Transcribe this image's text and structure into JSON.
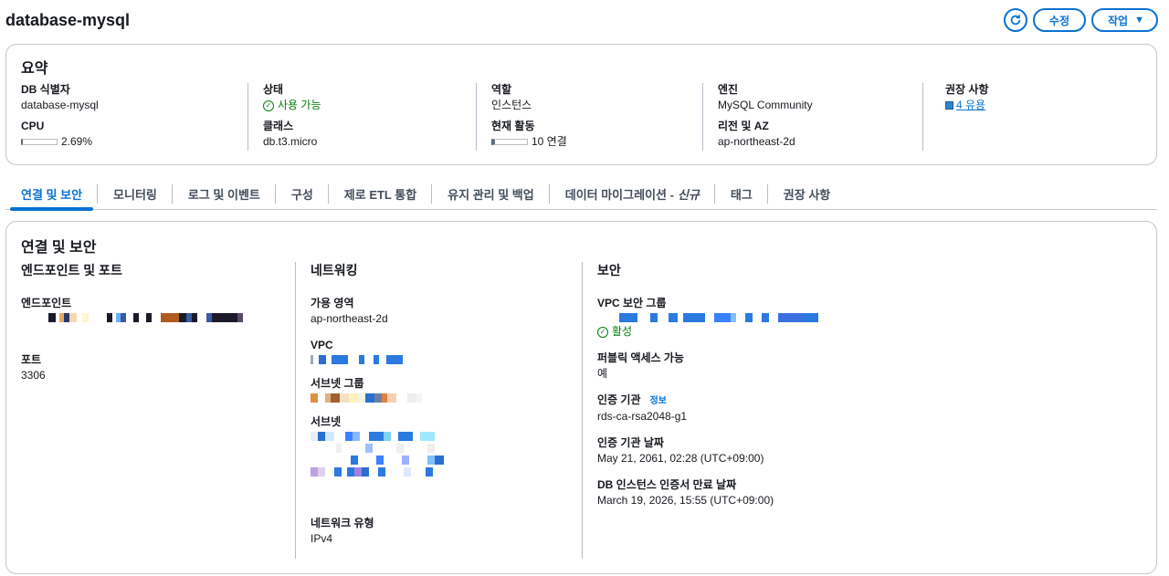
{
  "header": {
    "title": "database-mysql",
    "edit_label": "수정",
    "action_label": "작업"
  },
  "summary": {
    "title": "요약",
    "db_id": {
      "label": "DB 식별자",
      "value": "database-mysql"
    },
    "cpu": {
      "label": "CPU",
      "value": "2.69%",
      "fraction": 0.0269
    },
    "status": {
      "label": "상태",
      "value": "사용 가능"
    },
    "class": {
      "label": "클래스",
      "value": "db.t3.micro"
    },
    "role": {
      "label": "역할",
      "value": "인스턴스"
    },
    "activity": {
      "label": "현재 활동",
      "value": "10 연결"
    },
    "engine": {
      "label": "엔진",
      "value": "MySQL Community"
    },
    "region": {
      "label": "리전 및 AZ",
      "value": "ap-northeast-2d"
    },
    "recommendations": {
      "label": "권장 사항",
      "value": "4 유용"
    }
  },
  "tabs": [
    {
      "label": "연결 및 보안"
    },
    {
      "label": "모니터링"
    },
    {
      "label": "로그 및 이벤트"
    },
    {
      "label": "구성"
    },
    {
      "label": "제로 ETL 통합"
    },
    {
      "label": "유지 관리 및 백업"
    },
    {
      "label": "데이터 마이그레이션 -",
      "suffix": "신규"
    },
    {
      "label": "태그"
    },
    {
      "label": "권장 사항"
    }
  ],
  "details": {
    "title": "연결 및 보안",
    "endpoint_section": {
      "heading": "엔드포인트 및 포트",
      "endpoint_label": "엔드포인트",
      "port_label": "포트",
      "port_value": "3306"
    },
    "network_section": {
      "heading": "네트워킹",
      "az_label": "가용 영역",
      "az_value": "ap-northeast-2d",
      "vpc_label": "VPC",
      "subnet_group_label": "서브넷 그룹",
      "subnet_label": "서브넷",
      "network_type_label": "네트워크 유형",
      "network_type_value": "IPv4"
    },
    "security_section": {
      "heading": "보안",
      "sg_label": "VPC 보안 그룹",
      "sg_status": "활성",
      "public_label": "퍼블릭 액세스 가능",
      "public_value": "예",
      "ca_label": "인증 기관",
      "ca_info": "정보",
      "ca_value": "rds-ca-rsa2048-g1",
      "ca_date_label": "인증 기관 날짜",
      "ca_date_value": "May 21, 2061, 02:28 (UTC+09:00)",
      "cert_expiry_label": "DB 인스턴스 인증서 만료 날짜",
      "cert_expiry_value": "March 19, 2026, 15:55 (UTC+09:00)"
    }
  },
  "colors": {
    "accent": "#0972d3",
    "success": "#037f0c",
    "border": "#c6c6cd"
  },
  "icons": [
    "refresh-icon",
    "caret-down-icon",
    "check-circle-icon",
    "recommendation-icon"
  ]
}
